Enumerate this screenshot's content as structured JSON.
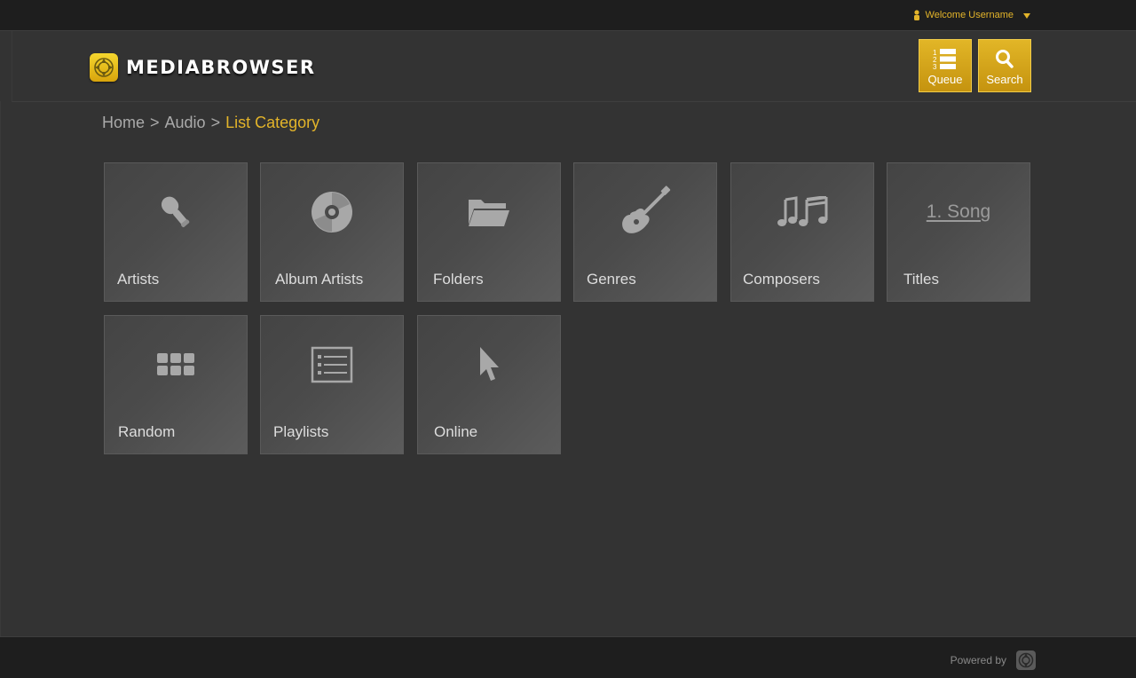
{
  "topbar": {
    "welcome_text": "Welcome Username",
    "user_icon": "user-icon",
    "dropdown_icon": "caret-down-icon"
  },
  "header": {
    "logo_text": "MEDIABROWSER",
    "queue_label": "Queue",
    "search_label": "Search"
  },
  "breadcrumb": {
    "items": [
      "Home",
      "Audio"
    ],
    "separator": ">",
    "current": "List Category"
  },
  "tiles": [
    {
      "label": "Artists",
      "icon": "microphone-icon"
    },
    {
      "label": "Album Artists",
      "icon": "disc-icon"
    },
    {
      "label": "Folders",
      "icon": "folder-icon"
    },
    {
      "label": "Genres",
      "icon": "guitar-icon"
    },
    {
      "label": "Composers",
      "icon": "music-notes-icon"
    },
    {
      "label": "Titles",
      "icon": "song-text-icon",
      "icon_text": "1. Song"
    },
    {
      "label": "Random",
      "icon": "grid-dots-icon"
    },
    {
      "label": "Playlists",
      "icon": "list-icon"
    },
    {
      "label": "Online",
      "icon": "cursor-icon"
    }
  ],
  "footer": {
    "powered_by": "Powered by"
  },
  "colors": {
    "accent": "#e3b42a",
    "background": "#333333",
    "bar": "#1e1e1e"
  }
}
